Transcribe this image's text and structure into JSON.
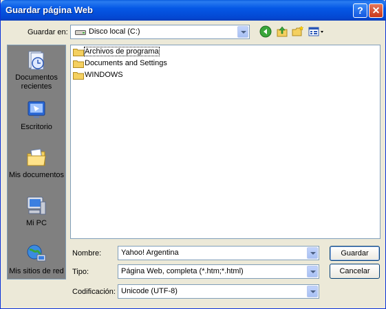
{
  "window": {
    "title": "Guardar página Web",
    "help_label": "?",
    "close_label": "✕"
  },
  "toolbar": {
    "save_in_label": "Guardar en:",
    "save_in_value": "Disco local (C:)",
    "icons": [
      "back-icon",
      "up-folder-icon",
      "new-folder-icon",
      "views-menu-icon"
    ]
  },
  "places": [
    {
      "label": "Documentos recientes",
      "icon": "recent-documents-icon"
    },
    {
      "label": "Escritorio",
      "icon": "desktop-icon"
    },
    {
      "label": "Mis documentos",
      "icon": "my-documents-icon"
    },
    {
      "label": "Mi PC",
      "icon": "my-computer-icon"
    },
    {
      "label": "Mis sitios de red",
      "icon": "network-places-icon"
    }
  ],
  "files": [
    {
      "name": "Archivos de programa"
    },
    {
      "name": "Documents and Settings"
    },
    {
      "name": "WINDOWS"
    }
  ],
  "form": {
    "name_label": "Nombre:",
    "name_value": "Yahoo! Argentina",
    "type_label": "Tipo:",
    "type_value": "Página Web, completa (*.htm;*.html)",
    "encoding_label": "Codificación:",
    "encoding_value": "Unicode (UTF-8)"
  },
  "buttons": {
    "save": "Guardar",
    "cancel": "Cancelar"
  },
  "colors": {
    "titlebar": "#0558e6",
    "dialog": "#ece9d8",
    "places_bg": "#808080",
    "border": "#7f9db9"
  }
}
